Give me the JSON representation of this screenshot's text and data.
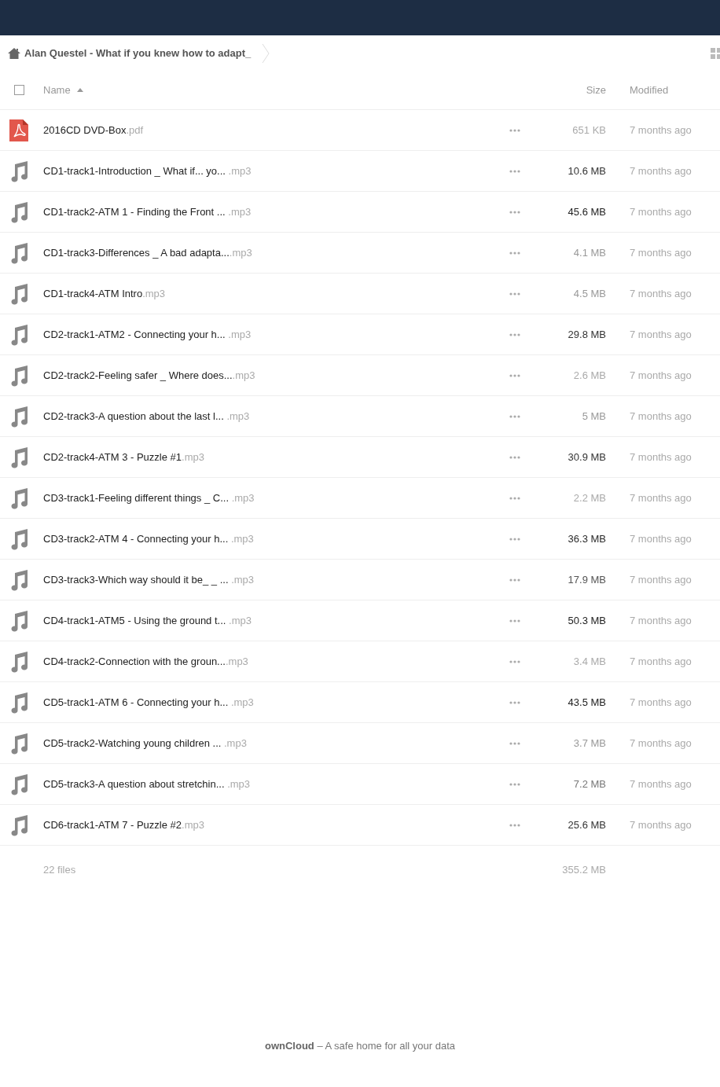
{
  "breadcrumb": {
    "label": "Alan Questel - What if you knew how to adapt_"
  },
  "table": {
    "columns": [
      "Name",
      "Size",
      "Modified"
    ],
    "select_all": {
      "checked": false
    },
    "sort": {
      "ascending": true
    },
    "rows": [
      {
        "kind": "pdf",
        "name": "2016CD DVD-Box",
        "ext": ".pdf",
        "size": "651 KB",
        "color": "#aaaaaa",
        "modified": "7 months ago"
      },
      {
        "kind": "audio",
        "name": "CD1-track1-Introduction _ What if... yo...",
        "ext": " .mp3",
        "size": "10.6 MB",
        "color": "#333333",
        "modified": "7 months ago"
      },
      {
        "kind": "audio",
        "name": "CD1-track2-ATM 1 - Finding the Front ...",
        "ext": " .mp3",
        "size": "45.6 MB",
        "color": "#222222",
        "modified": "7 months ago"
      },
      {
        "kind": "audio",
        "name": "CD1-track3-Differences _ A bad adapta...",
        "ext": ".mp3",
        "size": "4.1 MB",
        "color": "#999999",
        "modified": "7 months ago"
      },
      {
        "kind": "audio",
        "name": "CD1-track4-ATM Intro",
        "ext": ".mp3",
        "size": "4.5 MB",
        "color": "#999999",
        "modified": "7 months ago"
      },
      {
        "kind": "audio",
        "name": "CD2-track1-ATM2 - Connecting your h...",
        "ext": " .mp3",
        "size": "29.8 MB",
        "color": "#333333",
        "modified": "7 months ago"
      },
      {
        "kind": "audio",
        "name": "CD2-track2-Feeling safer _ Where does...",
        "ext": ".mp3",
        "size": "2.6 MB",
        "color": "#aaaaaa",
        "modified": "7 months ago"
      },
      {
        "kind": "audio",
        "name": "CD2-track3-A question about the last l...",
        "ext": " .mp3",
        "size": "5 MB",
        "color": "#999999",
        "modified": "7 months ago"
      },
      {
        "kind": "audio",
        "name": "CD2-track4-ATM 3 - Puzzle #1",
        "ext": ".mp3",
        "size": "30.9 MB",
        "color": "#333333",
        "modified": "7 months ago"
      },
      {
        "kind": "audio",
        "name": "CD3-track1-Feeling different things _ C...",
        "ext": " .mp3",
        "size": "2.2 MB",
        "color": "#aaaaaa",
        "modified": "7 months ago"
      },
      {
        "kind": "audio",
        "name": "CD3-track2-ATM 4 - Connecting your h...",
        "ext": " .mp3",
        "size": "36.3 MB",
        "color": "#2a2a2a",
        "modified": "7 months ago"
      },
      {
        "kind": "audio",
        "name": "CD3-track3-Which way should it be_ _ ...",
        "ext": " .mp3",
        "size": "17.9 MB",
        "color": "#555555",
        "modified": "7 months ago"
      },
      {
        "kind": "audio",
        "name": "CD4-track1-ATM5 - Using the ground t...",
        "ext": " .mp3",
        "size": "50.3 MB",
        "color": "#222222",
        "modified": "7 months ago"
      },
      {
        "kind": "audio",
        "name": "CD4-track2-Connection with the groun...",
        "ext": ".mp3",
        "size": "3.4 MB",
        "color": "#aaaaaa",
        "modified": "7 months ago"
      },
      {
        "kind": "audio",
        "name": "CD5-track1-ATM 6 - Connecting your h...",
        "ext": " .mp3",
        "size": "43.5 MB",
        "color": "#222222",
        "modified": "7 months ago"
      },
      {
        "kind": "audio",
        "name": "CD5-track2-Watching young children ...",
        "ext": " .mp3",
        "size": "3.7 MB",
        "color": "#999999",
        "modified": "7 months ago"
      },
      {
        "kind": "audio",
        "name": "CD5-track3-A question about stretchin...",
        "ext": " .mp3",
        "size": "7.2 MB",
        "color": "#777777",
        "modified": "7 months ago"
      },
      {
        "kind": "audio",
        "name": "CD6-track1-ATM 7 - Puzzle #2",
        "ext": ".mp3",
        "size": "25.6 MB",
        "color": "#333333",
        "modified": "7 months ago"
      }
    ],
    "summary": {
      "count": "22 files",
      "total": "355.2 MB"
    }
  },
  "footer": {
    "brand": "ownCloud",
    "tagline": " – A safe home for all your data"
  }
}
